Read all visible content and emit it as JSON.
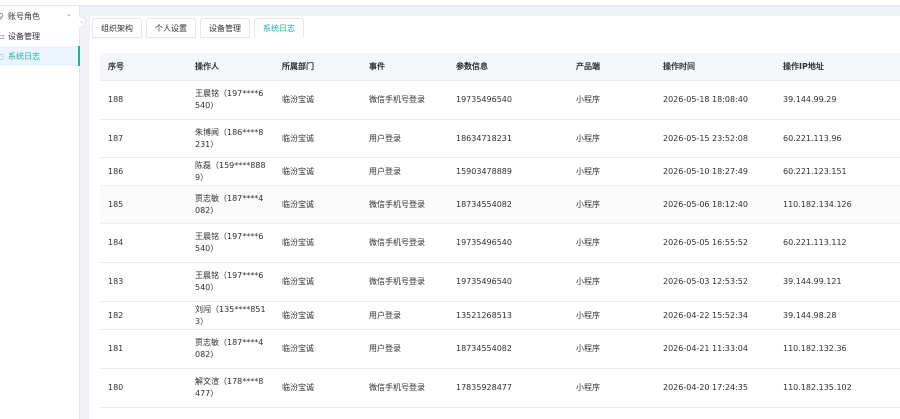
{
  "sidebar": {
    "items": [
      {
        "icon": "user-role-icon",
        "glyph": "⚲",
        "label": "账号角色",
        "chevron": "⌄"
      },
      {
        "icon": "device-icon",
        "glyph": "▭",
        "label": "设备管理"
      },
      {
        "icon": "log-icon",
        "glyph": "◌",
        "label": "系统日志"
      }
    ],
    "collapse_glyph": "‹"
  },
  "tabs": [
    {
      "label": "组织架构"
    },
    {
      "label": "个人设置"
    },
    {
      "label": "设备管理"
    },
    {
      "label": "系统日志"
    }
  ],
  "table": {
    "headers": [
      "序号",
      "操作人",
      "所属部门",
      "事件",
      "参数信息",
      "产品端",
      "操作时间",
      "操作IP地址"
    ],
    "rows": [
      {
        "id": "188",
        "operator": "王晨铭（197****6540）",
        "dept": "临汾宝诚",
        "event": "微信手机号登录",
        "param": "19735496540",
        "product": "小程序",
        "time": "2026-05-18 18:08:40",
        "ip": "39.144.99.29"
      },
      {
        "id": "187",
        "operator": "朱博闻（186****8231）",
        "dept": "临汾宝诚",
        "event": "用户登录",
        "param": "18634718231",
        "product": "小程序",
        "time": "2026-05-15 23:52:08",
        "ip": "60.221.113.96"
      },
      {
        "id": "186",
        "operator": "陈磊（159****8889）",
        "dept": "临汾宝诚",
        "event": "用户登录",
        "param": "15903478889",
        "product": "小程序",
        "time": "2026-05-10 18:27:49",
        "ip": "60.221.123.151"
      },
      {
        "id": "185",
        "operator": "贾志敏（187****4082）",
        "dept": "临汾宝诚",
        "event": "微信手机号登录",
        "param": "18734554082",
        "product": "小程序",
        "time": "2026-05-06 18:12:40",
        "ip": "110.182.134.126"
      },
      {
        "id": "184",
        "operator": "王晨铭（197****6540）",
        "dept": "临汾宝诚",
        "event": "微信手机号登录",
        "param": "19735496540",
        "product": "小程序",
        "time": "2026-05-05 16:55:52",
        "ip": "60.221.113.112"
      },
      {
        "id": "183",
        "operator": "王晨铭（197****6540）",
        "dept": "临汾宝诚",
        "event": "微信手机号登录",
        "param": "19735496540",
        "product": "小程序",
        "time": "2026-05-03 12:53:52",
        "ip": "39.144.99.121"
      },
      {
        "id": "182",
        "operator": "刘闯（135****8513）",
        "dept": "临汾宝诚",
        "event": "用户登录",
        "param": "13521268513",
        "product": "小程序",
        "time": "2026-04-22 15:52:34",
        "ip": "39.144.98.28"
      },
      {
        "id": "181",
        "operator": "贾志敏（187****4082）",
        "dept": "临汾宝诚",
        "event": "用户登录",
        "param": "18734554082",
        "product": "小程序",
        "time": "2026-04-21 11:33:04",
        "ip": "110.182.132.36"
      },
      {
        "id": "180",
        "operator": "解文渲（178****8477）",
        "dept": "临汾宝诚",
        "event": "微信手机号登录",
        "param": "17835928477",
        "product": "小程序",
        "time": "2026-04-20 17:24:35",
        "ip": "110.182.135.102"
      }
    ]
  },
  "colors": {
    "accent": "#1ab394",
    "page_bg": "#f0f2f5",
    "header_bg": "#f5f7fa",
    "border": "#ebeef5"
  }
}
